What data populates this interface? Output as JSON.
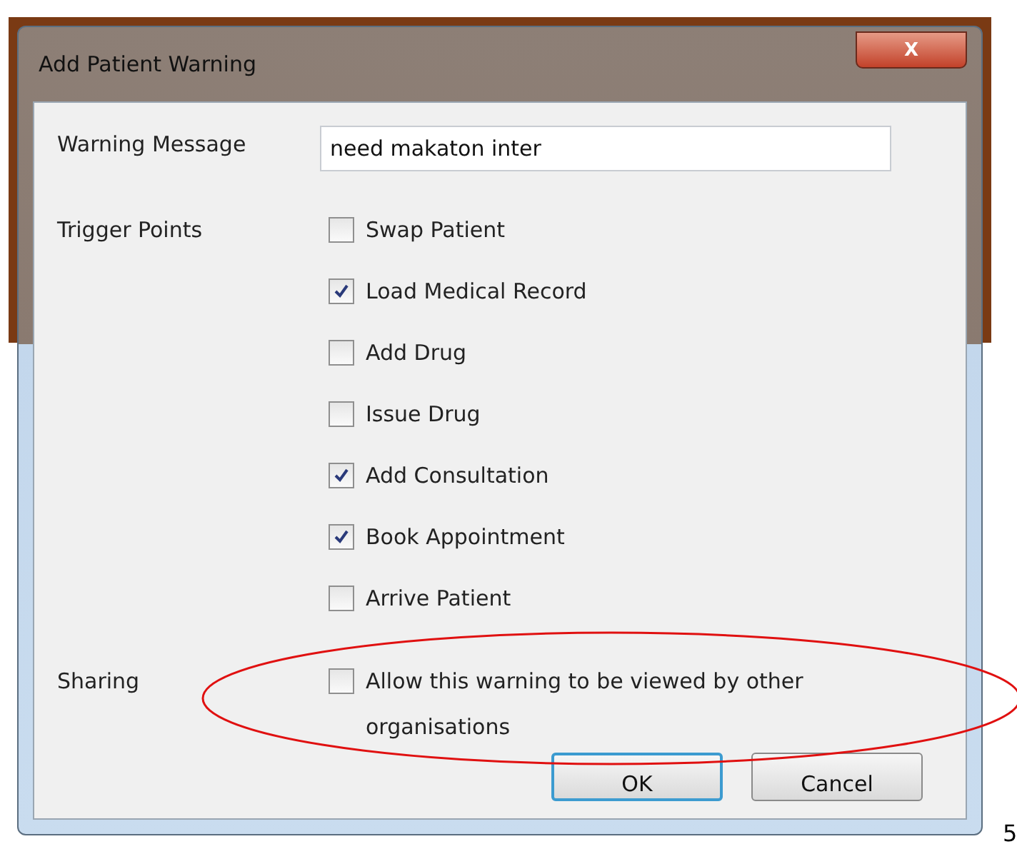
{
  "window": {
    "title": "Add Patient Warning",
    "close_label": "X"
  },
  "warning_message": {
    "label": "Warning Message",
    "value": "need makaton inter"
  },
  "trigger_points": {
    "label": "Trigger Points",
    "options": [
      {
        "label": "Swap Patient",
        "checked": false
      },
      {
        "label": "Load Medical Record",
        "checked": true
      },
      {
        "label": "Add Drug",
        "checked": false
      },
      {
        "label": "Issue Drug",
        "checked": false
      },
      {
        "label": "Add Consultation",
        "checked": true
      },
      {
        "label": "Book Appointment",
        "checked": true
      },
      {
        "label": "Arrive Patient",
        "checked": false
      }
    ]
  },
  "sharing": {
    "label": "Sharing",
    "option": {
      "label": "Allow this warning to be viewed by other organisations",
      "checked": false
    }
  },
  "buttons": [
    {
      "label": "OK",
      "default": true
    },
    {
      "label": "Cancel",
      "default": false
    }
  ],
  "page_number": "5"
}
